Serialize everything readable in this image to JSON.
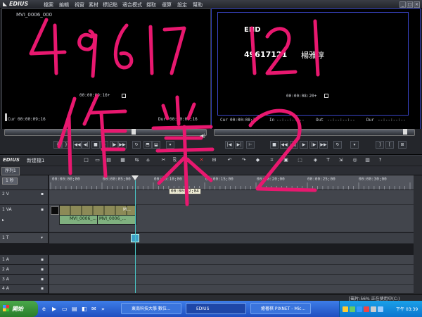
{
  "menubar": {
    "app_name": "EDIUS",
    "items": [
      "檔案",
      "編輯",
      "視窗",
      "素材",
      "標記點",
      "適合模式",
      "擷取",
      "運算",
      "設定",
      "幫助"
    ]
  },
  "player": {
    "clip_name": "MVI_0006_000",
    "timecode": "00:00:09:16+",
    "cur_label": "Cur",
    "cur_value": "00:00:09;16",
    "dur_label": "Dur",
    "dur_value": "00:00:09;16"
  },
  "recorder": {
    "end_label": "END",
    "subtitle": "49617121",
    "name": "楊雅淳",
    "timecode": "00:00:08:20+",
    "cur_label": "Cur",
    "cur_value": "00:00:08;20",
    "in_label": "In",
    "in_value": "--:--:--:--",
    "out_label": "Out",
    "out_value": "--:--:--:--",
    "dur_label": "Dur",
    "dur_value": "--:--:--:--"
  },
  "annotation": {
    "line1": "49617121",
    "line2": "作業2",
    "color": "#e8186f"
  },
  "timeline": {
    "app_name": "EDIUS",
    "project_name": "新建檔1",
    "sequence_tab": "序列1",
    "zoom_label": "1 秒",
    "ruler_labels": [
      "00:00:00;00",
      "00:00:05;00",
      "00:00:10;00",
      "00:00:15;00",
      "00:00:20;00",
      "00:00:25;00",
      "00:00:30;00"
    ],
    "playhead_tooltip": "00:00:12;04",
    "tracks": [
      {
        "id": "2V",
        "label": "2 V"
      },
      {
        "id": "1VA",
        "label": "1 VA"
      },
      {
        "id": "1T",
        "label": "1 T"
      },
      {
        "id": "1A",
        "label": "1 A"
      },
      {
        "id": "2A",
        "label": "2 A"
      },
      {
        "id": "3A",
        "label": "3 A"
      },
      {
        "id": "4A",
        "label": "4 A"
      }
    ],
    "clips": [
      "MVI_0006_...",
      "MVI_0006_..."
    ],
    "clip_thumb_label": "M...",
    "status_text": "[磁片:56% 正在使用中(C:)"
  },
  "taskbar": {
    "start_label": "開始",
    "tasks": [
      {
        "label": "東南科技大學 數位...",
        "active": false
      },
      {
        "label": "EDIUS",
        "active": true
      },
      {
        "label": "癒著棋 PIXNET - Mic...",
        "active": false
      }
    ],
    "clock": "下午 03:39"
  }
}
